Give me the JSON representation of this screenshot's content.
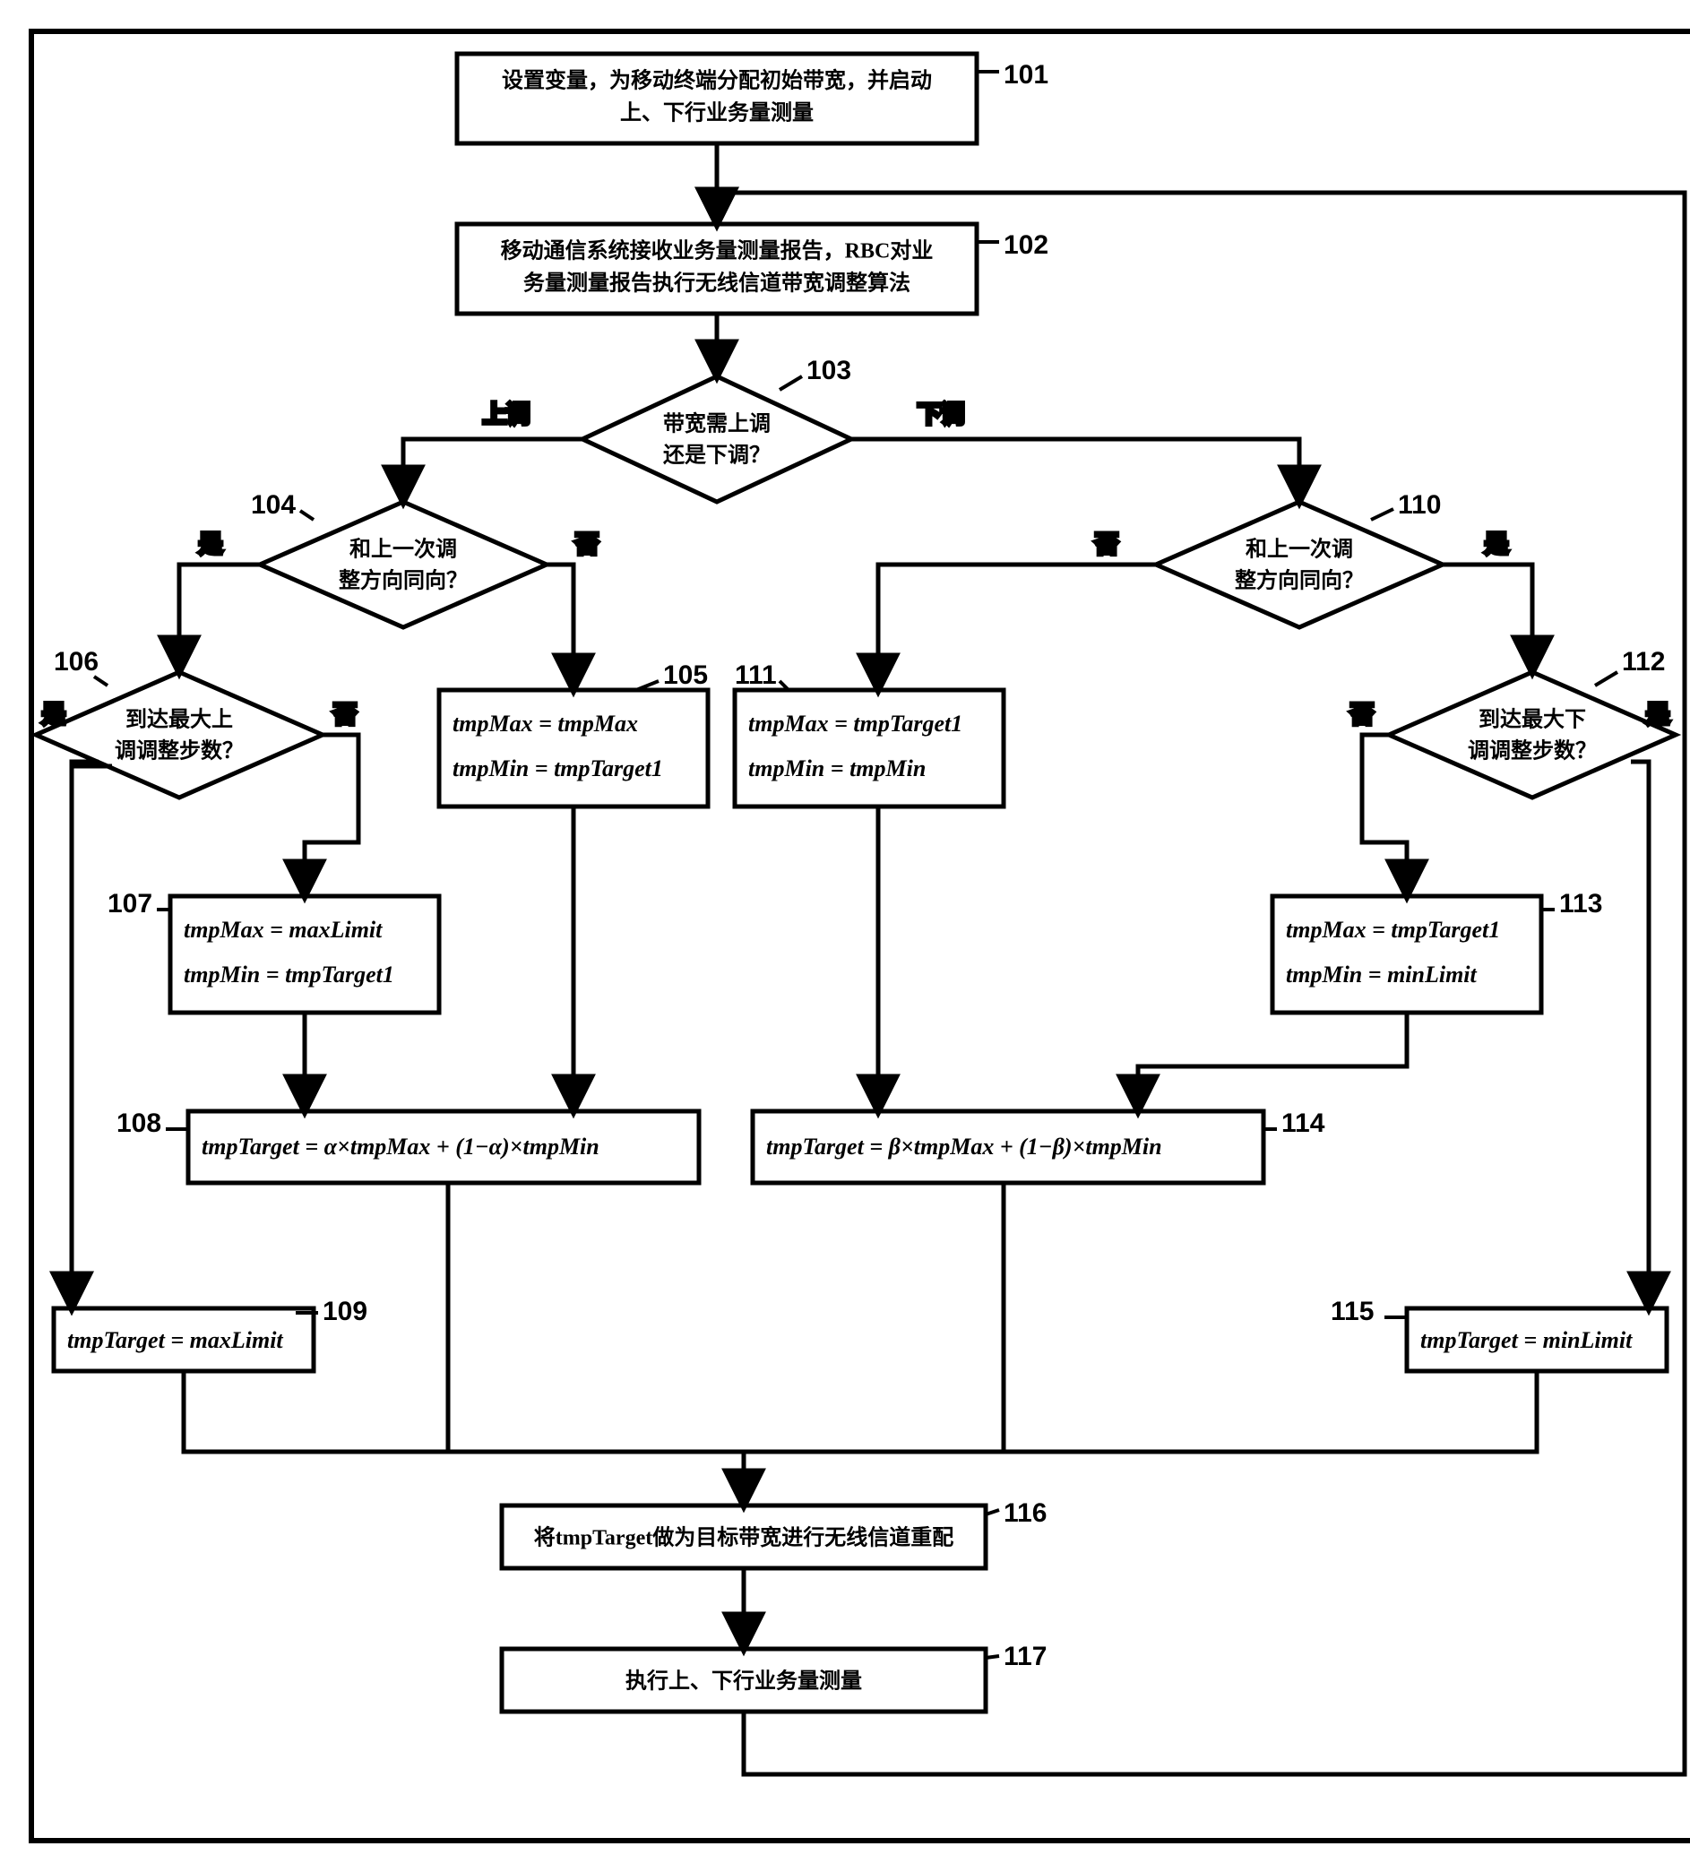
{
  "nodes": {
    "n101": {
      "num": "101",
      "line1": "设置变量，为移动终端分配初始带宽，并启动",
      "line2": "上、下行业务量测量"
    },
    "n102": {
      "num": "102",
      "line1": "移动通信系统接收业务量测量报告，RBC对业",
      "line2": "务量测量报告执行无线信道带宽调整算法"
    },
    "n103": {
      "num": "103",
      "line1": "带宽需上调",
      "line2": "还是下调？"
    },
    "n104": {
      "num": "104",
      "line1": "和上一次调",
      "line2": "整方向同向？"
    },
    "n105": {
      "num": "105",
      "line1": "tmpMax = tmpMax",
      "line2": "tmpMin = tmpTarget1"
    },
    "n106": {
      "num": "106",
      "line1": "到达最大上",
      "line2": "调调整步数？"
    },
    "n107": {
      "num": "107",
      "line1": "tmpMax = maxLimit",
      "line2": "tmpMin = tmpTarget1"
    },
    "n108": {
      "num": "108",
      "line1": "tmpTarget = α×tmpMax + (1−α)×tmpMin"
    },
    "n109": {
      "num": "109",
      "line1": "tmpTarget = maxLimit"
    },
    "n110": {
      "num": "110",
      "line1": "和上一次调",
      "line2": "整方向同向？"
    },
    "n111": {
      "num": "111",
      "line1": "tmpMax = tmpTarget1",
      "line2": "tmpMin = tmpMin"
    },
    "n112": {
      "num": "112",
      "line1": "到达最大下",
      "line2": "调调整步数？"
    },
    "n113": {
      "num": "113",
      "line1": "tmpMax = tmpTarget1",
      "line2": "tmpMin = minLimit"
    },
    "n114": {
      "num": "114",
      "line1": "tmpTarget = β×tmpMax + (1−β)×tmpMin"
    },
    "n115": {
      "num": "115",
      "line1": "tmpTarget = minLimit"
    },
    "n116": {
      "num": "116",
      "line1": "将tmpTarget做为目标带宽进行无线信道重配"
    },
    "n117": {
      "num": "117",
      "line1": "执行上、下行业务量测量"
    }
  },
  "edgeLabels": {
    "up": "上调",
    "down": "下调",
    "yes": "是",
    "no": "否"
  }
}
